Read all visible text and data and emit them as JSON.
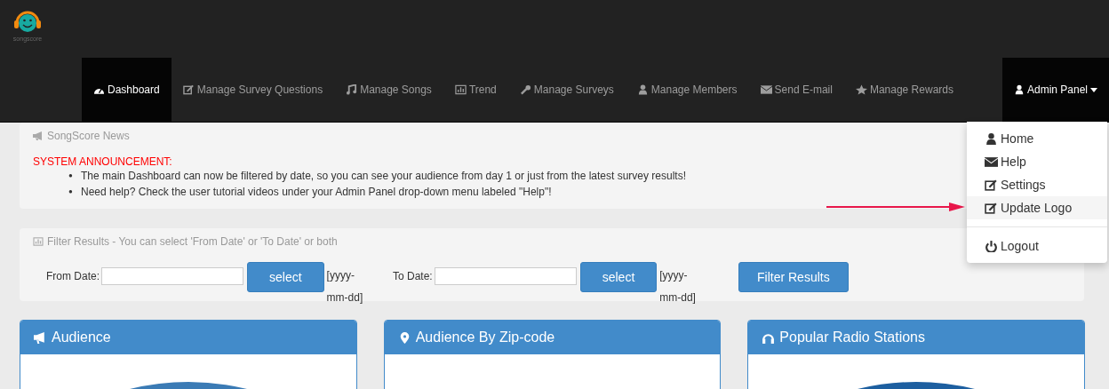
{
  "logo": {
    "text": "songscore"
  },
  "nav": [
    {
      "label": "Dashboard",
      "selected": true
    },
    {
      "label": "Manage Survey Questions",
      "selected": false
    },
    {
      "label": "Manage Songs",
      "selected": false
    },
    {
      "label": "Trend",
      "selected": false
    },
    {
      "label": "Manage Surveys",
      "selected": false
    },
    {
      "label": "Manage Members",
      "selected": false
    },
    {
      "label": "Send E-mail",
      "selected": false
    },
    {
      "label": "Manage Rewards",
      "selected": false
    }
  ],
  "admin_menu": {
    "label": "Admin Panel",
    "expanded": true,
    "items": [
      {
        "label": "Home",
        "selected": false
      },
      {
        "label": "Help",
        "selected": false
      },
      {
        "label": "Settings",
        "selected": false
      },
      {
        "label": "Update Logo",
        "selected": true
      },
      {
        "label": "Logout",
        "selected": false
      }
    ]
  },
  "news": {
    "title": "SongScore News",
    "announcement": "SYSTEM ANNOUNCEMENT:",
    "items": [
      {
        "bullet": "●",
        "text": "The main Dashboard can now be filtered by date, so you can see your audience from day 1 or just from the latest survey results!"
      },
      {
        "bullet": "●",
        "text": "Need help? Check the user tutorial videos under your Admin Panel drop-down menu labeled \"Help\"!"
      }
    ]
  },
  "filter": {
    "title": "Filter Results - You can select 'From Date' or 'To Date' or both",
    "fields": [
      {
        "label": "From Date:",
        "button": "select",
        "hint": "[yyyy-mm-dd]"
      },
      {
        "label": "To Date:",
        "button": "select",
        "hint": "[yyyy-mm-dd]"
      }
    ],
    "submit": "Filter Results"
  },
  "cards": [
    {
      "title": "Audience"
    },
    {
      "title": "Audience By Zip-code"
    },
    {
      "title": "Popular Radio Stations"
    }
  ]
}
